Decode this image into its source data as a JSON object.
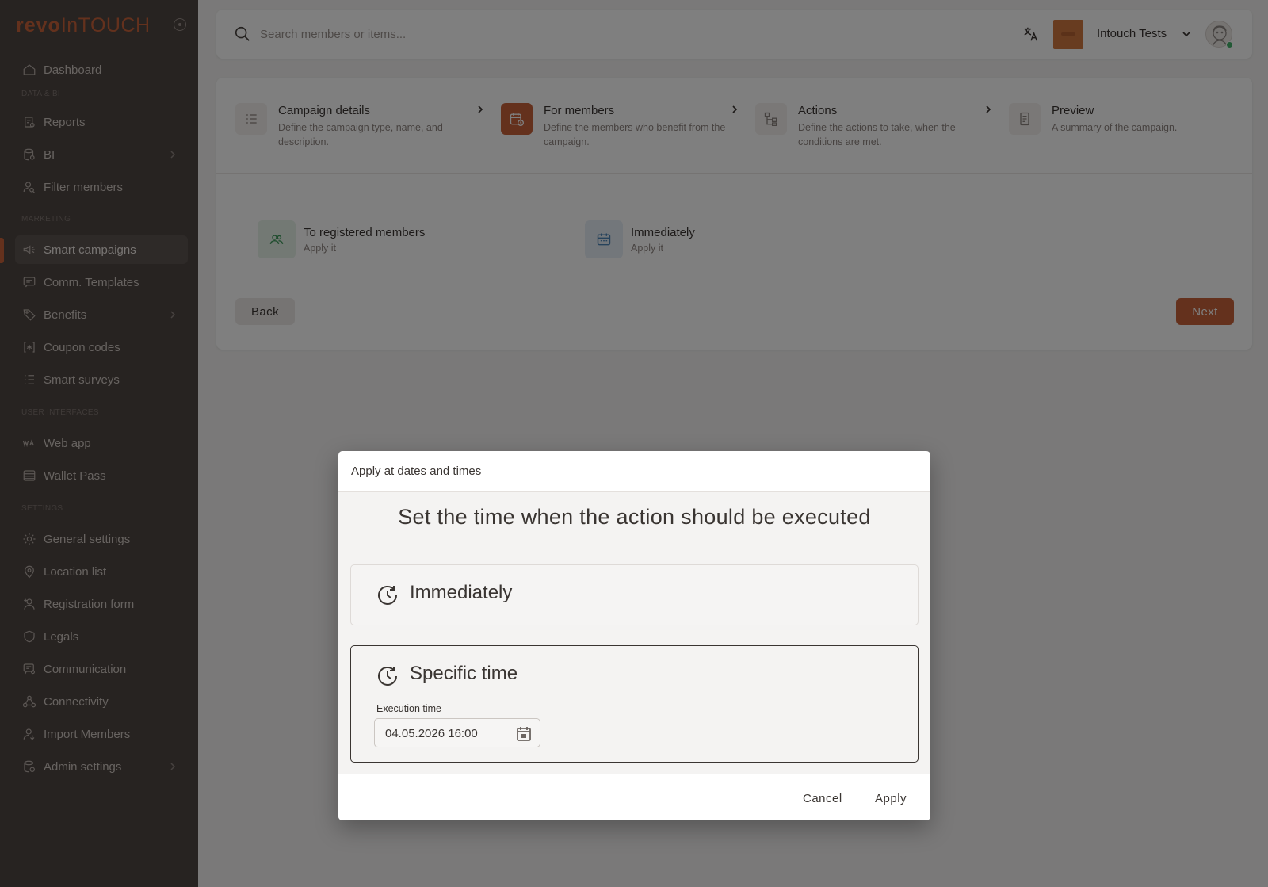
{
  "sidebar": {
    "logo": {
      "part1": "revo",
      "part2": "InTOUCH"
    },
    "items": {
      "dashboard": "Dashboard",
      "reports": "Reports",
      "bi": "BI",
      "filter_members": "Filter members",
      "smart_campaigns": "Smart campaigns",
      "comm_templates": "Comm. Templates",
      "benefits": "Benefits",
      "coupon_codes": "Coupon codes",
      "smart_surveys": "Smart surveys",
      "web_app": "Web app",
      "wallet_pass": "Wallet Pass",
      "general_settings": "General settings",
      "location_list": "Location list",
      "registration_form": "Registration form",
      "legals": "Legals",
      "communication": "Communication",
      "connectivity": "Connectivity",
      "import_members": "Import Members",
      "admin_settings": "Admin settings"
    },
    "sections": {
      "data_bi": "DATA & BI",
      "marketing": "MARKETING",
      "user_interfaces": "USER INTERFACES",
      "settings": "SETTINGS"
    },
    "active_item": "Smart campaigns"
  },
  "topbar": {
    "search_placeholder": "Search members or items...",
    "search_value": "",
    "org_name": "Intouch Tests"
  },
  "wizard": {
    "steps": [
      {
        "title": "Campaign details",
        "description": "Define the campaign type, name, and description."
      },
      {
        "title": "For members",
        "description": "Define the members who benefit from the campaign."
      },
      {
        "title": "Actions",
        "description": "Define the actions to take, when the conditions are met."
      },
      {
        "title": "Preview",
        "description": "A summary of the campaign."
      }
    ],
    "active_step": 2,
    "options": [
      {
        "title": "To registered members",
        "subtitle": "Apply it"
      },
      {
        "title": "Immediately",
        "subtitle": "Apply it"
      }
    ],
    "back_label": "Back",
    "next_label": "Next"
  },
  "dialog": {
    "title": "Apply at dates and times",
    "heading": "Set the time when the action should be executed",
    "choices": [
      {
        "label": "Immediately",
        "selected": false
      },
      {
        "label": "Specific time",
        "selected": true
      }
    ],
    "execution_time_label": "Execution time",
    "execution_time_value": "04.05.2026 16:00",
    "cancel_label": "Cancel",
    "apply_label": "Apply"
  },
  "colors": {
    "accent": "#c8633a",
    "sidebar_bg": "#4e4642",
    "overlay": "rgba(0,0,0,0.5)"
  }
}
